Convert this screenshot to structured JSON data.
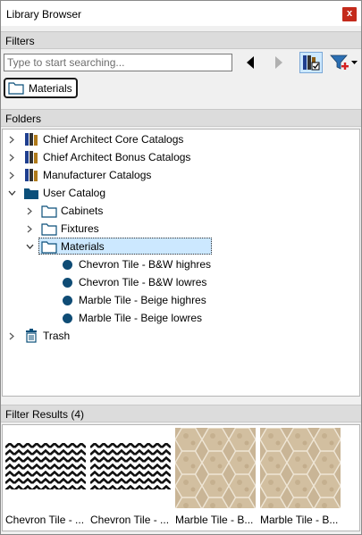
{
  "window": {
    "title": "Library Browser",
    "close_label": "x"
  },
  "filters": {
    "header": "Filters",
    "search_placeholder": "Type to start searching...",
    "active_filter": "Materials"
  },
  "folders": {
    "header": "Folders",
    "items": [
      {
        "label": "Chief Architect Core Catalogs",
        "icon": "catalog-books-icon"
      },
      {
        "label": "Chief Architect Bonus Catalogs",
        "icon": "catalog-books-icon"
      },
      {
        "label": "Manufacturer Catalogs",
        "icon": "catalog-books-icon"
      },
      {
        "label": "User Catalog",
        "icon": "folder-filled-icon"
      },
      {
        "label": "Cabinets",
        "icon": "folder-icon"
      },
      {
        "label": "Fixtures",
        "icon": "folder-icon"
      },
      {
        "label": "Materials",
        "icon": "folder-icon"
      },
      {
        "label": "Chevron Tile - B&W highres",
        "icon": "material-dot-icon"
      },
      {
        "label": "Chevron Tile - B&W lowres",
        "icon": "material-dot-icon"
      },
      {
        "label": "Marble Tile - Beige highres",
        "icon": "material-dot-icon"
      },
      {
        "label": "Marble Tile - Beige lowres",
        "icon": "material-dot-icon"
      },
      {
        "label": "Trash",
        "icon": "trash-icon"
      }
    ]
  },
  "results": {
    "header": "Filter Results (4)",
    "items": [
      {
        "caption": "Chevron Tile - ...",
        "pattern": "chevron-bw"
      },
      {
        "caption": "Chevron Tile - ...",
        "pattern": "chevron-bw"
      },
      {
        "caption": "Marble Tile - B...",
        "pattern": "marble-beige"
      },
      {
        "caption": "Marble Tile - B...",
        "pattern": "marble-beige"
      }
    ]
  },
  "colors": {
    "selection": "#cce8ff",
    "material_dot": "#0f4c75",
    "close": "#c42b1c"
  }
}
